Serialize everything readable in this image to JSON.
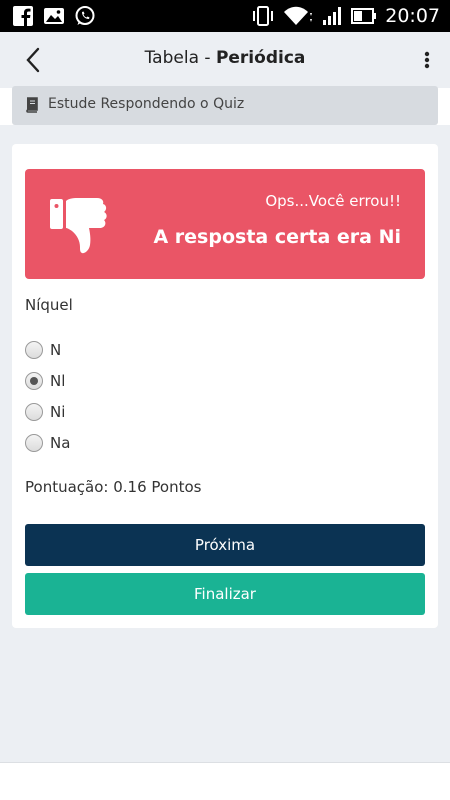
{
  "status_bar": {
    "time": "20:07",
    "left_icons": [
      "facebook-icon",
      "image-icon",
      "whatsapp-icon"
    ],
    "right_icons": [
      "vibrate-icon",
      "wifi-icon",
      "signal-icon",
      "battery-icon"
    ]
  },
  "header": {
    "title_prefix": "Tabela - ",
    "title_bold": "Periódica",
    "back_icon": "chevron-left-icon",
    "menu_icon": "more-vertical-icon"
  },
  "banner": {
    "icon": "book-icon",
    "text": "Estude Respondendo o Quiz"
  },
  "alert": {
    "icon": "thumbs-down-icon",
    "subtitle": "Ops...Você errou!!",
    "message": "A resposta certa era Ni",
    "color": "#ea5566"
  },
  "quiz": {
    "question": "Níquel",
    "options": [
      {
        "label": "N",
        "selected": false
      },
      {
        "label": "Nl",
        "selected": true
      },
      {
        "label": "Ni",
        "selected": false
      },
      {
        "label": "Na",
        "selected": false
      }
    ],
    "score_text": "Pontuação: 0.16 Pontos"
  },
  "actions": {
    "next_label": "Próxima",
    "next_color": "#0b3353",
    "finish_label": "Finalizar",
    "finish_color": "#1ab394"
  }
}
